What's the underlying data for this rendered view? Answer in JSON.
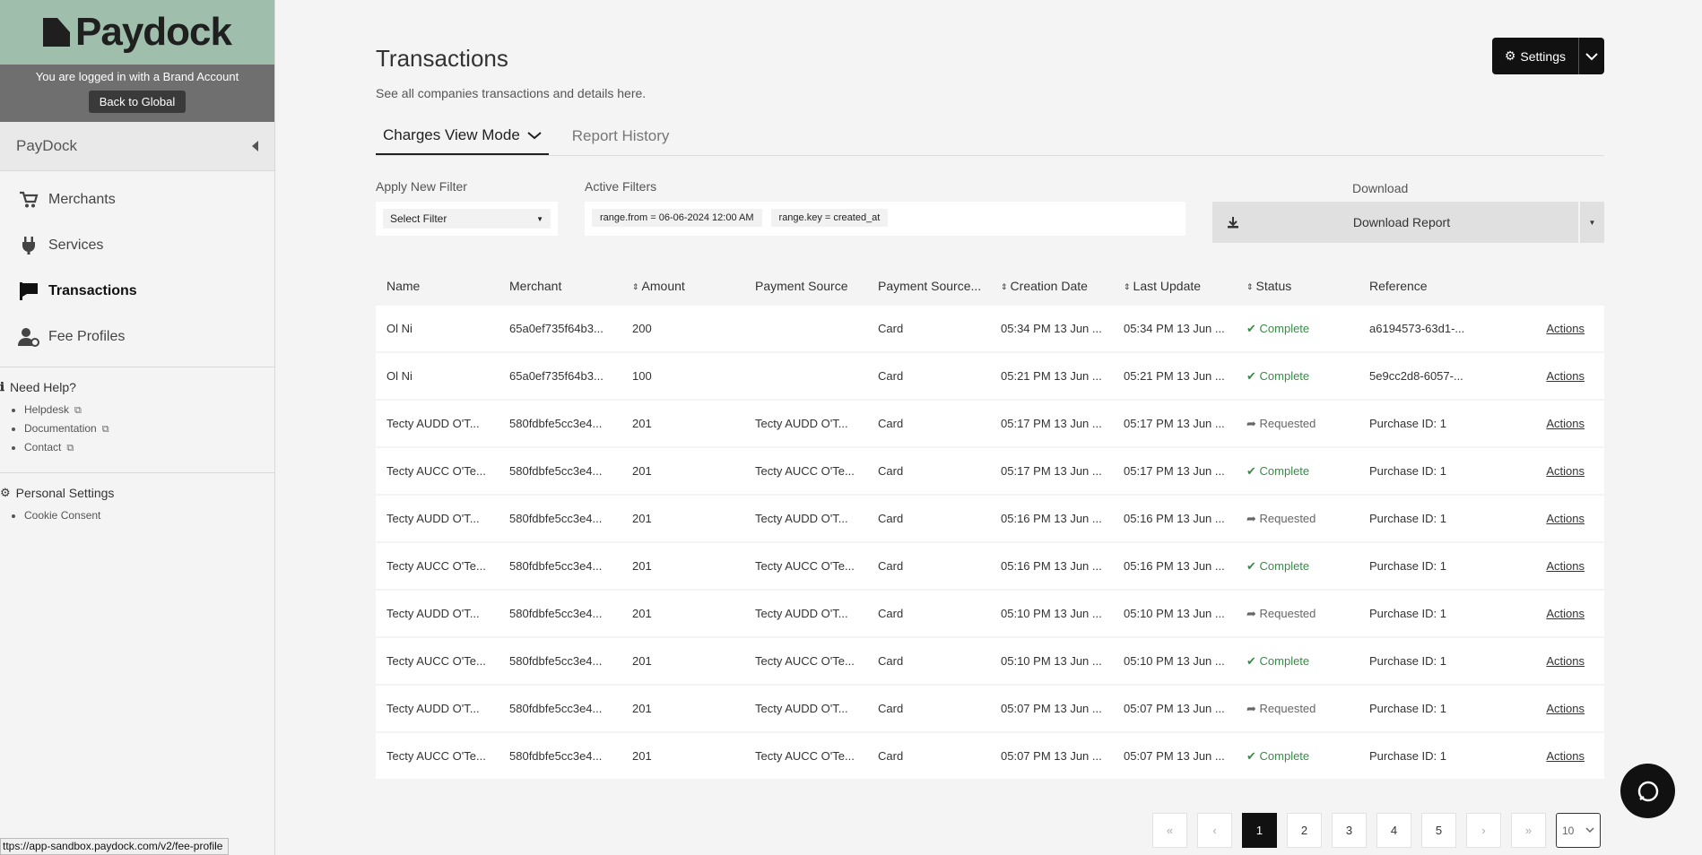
{
  "brand": {
    "name": "Paydock",
    "login_message": "You are logged in with a Brand Account",
    "back_label": "Back to Global"
  },
  "sidebar": {
    "company": "PayDock",
    "items": [
      {
        "label": "Merchants",
        "icon": "cart-icon"
      },
      {
        "label": "Services",
        "icon": "plug-icon"
      },
      {
        "label": "Transactions",
        "icon": "flag-icon"
      },
      {
        "label": "Fee Profiles",
        "icon": "users-gear-icon"
      }
    ],
    "help": {
      "title": "Need Help?",
      "links": [
        "Helpdesk",
        "Documentation",
        "Contact"
      ]
    },
    "personal": {
      "title": "Personal Settings",
      "links": [
        "Cookie Consent"
      ]
    }
  },
  "header": {
    "title": "Transactions",
    "subtitle": "See all companies transactions and details here.",
    "settings_label": "Settings"
  },
  "tabs": [
    "Charges View Mode",
    "Report History"
  ],
  "filters": {
    "apply_label": "Apply New Filter",
    "select_placeholder": "Select Filter",
    "active_label": "Active Filters",
    "chips": [
      "range.from = 06-06-2024 12:00 AM",
      "range.key = created_at"
    ],
    "download_label": "Download",
    "download_button": "Download Report"
  },
  "table": {
    "columns": [
      "Name",
      "Merchant",
      "Amount",
      "Payment Source",
      "Payment Source...",
      "Creation Date",
      "Last Update",
      "Status",
      "Reference",
      ""
    ],
    "rows": [
      [
        "Ol Ni",
        "65a0ef735f64b3...",
        "200",
        "",
        "Card",
        "05:34 PM 13 Jun ...",
        "05:34 PM 13 Jun ...",
        "Complete",
        "a6194573-63d1-...",
        "Actions"
      ],
      [
        "Ol Ni",
        "65a0ef735f64b3...",
        "100",
        "",
        "Card",
        "05:21 PM 13 Jun ...",
        "05:21 PM 13 Jun ...",
        "Complete",
        "5e9cc2d8-6057-...",
        "Actions"
      ],
      [
        "Tecty AUDD O'T...",
        "580fdbfe5cc3e4...",
        "201",
        "Tecty AUDD O'T...",
        "Card",
        "05:17 PM 13 Jun ...",
        "05:17 PM 13 Jun ...",
        "Requested",
        "Purchase ID: 1",
        "Actions"
      ],
      [
        "Tecty AUCC O'Te...",
        "580fdbfe5cc3e4...",
        "201",
        "Tecty AUCC O'Te...",
        "Card",
        "05:17 PM 13 Jun ...",
        "05:17 PM 13 Jun ...",
        "Complete",
        "Purchase ID: 1",
        "Actions"
      ],
      [
        "Tecty AUDD O'T...",
        "580fdbfe5cc3e4...",
        "201",
        "Tecty AUDD O'T...",
        "Card",
        "05:16 PM 13 Jun ...",
        "05:16 PM 13 Jun ...",
        "Requested",
        "Purchase ID: 1",
        "Actions"
      ],
      [
        "Tecty AUCC O'Te...",
        "580fdbfe5cc3e4...",
        "201",
        "Tecty AUCC O'Te...",
        "Card",
        "05:16 PM 13 Jun ...",
        "05:16 PM 13 Jun ...",
        "Complete",
        "Purchase ID: 1",
        "Actions"
      ],
      [
        "Tecty AUDD O'T...",
        "580fdbfe5cc3e4...",
        "201",
        "Tecty AUDD O'T...",
        "Card",
        "05:10 PM 13 Jun ...",
        "05:10 PM 13 Jun ...",
        "Requested",
        "Purchase ID: 1",
        "Actions"
      ],
      [
        "Tecty AUCC O'Te...",
        "580fdbfe5cc3e4...",
        "201",
        "Tecty AUCC O'Te...",
        "Card",
        "05:10 PM 13 Jun ...",
        "05:10 PM 13 Jun ...",
        "Complete",
        "Purchase ID: 1",
        "Actions"
      ],
      [
        "Tecty AUDD O'T...",
        "580fdbfe5cc3e4...",
        "201",
        "Tecty AUDD O'T...",
        "Card",
        "05:07 PM 13 Jun ...",
        "05:07 PM 13 Jun ...",
        "Requested",
        "Purchase ID: 1",
        "Actions"
      ],
      [
        "Tecty AUCC O'Te...",
        "580fdbfe5cc3e4...",
        "201",
        "Tecty AUCC O'Te...",
        "Card",
        "05:07 PM 13 Jun ...",
        "05:07 PM 13 Jun ...",
        "Complete",
        "Purchase ID: 1",
        "Actions"
      ]
    ]
  },
  "pagination": {
    "first": "«",
    "prev": "‹",
    "next": "›",
    "last": "»",
    "pages": [
      "1",
      "2",
      "3",
      "4",
      "5"
    ],
    "current": "1",
    "page_size": "10"
  },
  "status_bar_url": "ttps://app-sandbox.paydock.com/v2/fee-profile",
  "colors": {
    "brand_bg": "#9fbfac",
    "complete": "#3a8a4a",
    "primary": "#111111"
  }
}
